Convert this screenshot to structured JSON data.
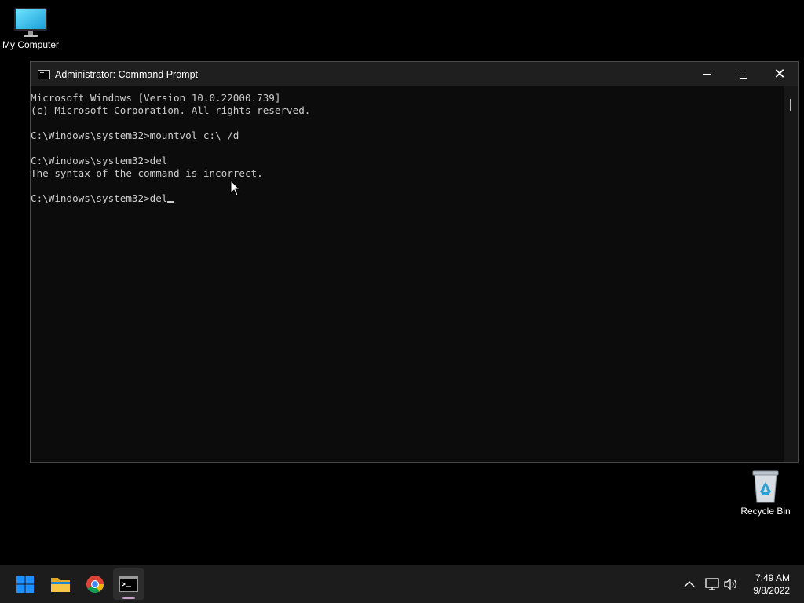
{
  "desktop": {
    "icons": [
      {
        "label": "My Computer",
        "icon": "monitor-icon"
      },
      {
        "label": "Recycle Bin",
        "icon": "recycle-bin-icon"
      }
    ]
  },
  "window": {
    "title": "Administrator: Command Prompt",
    "controls": [
      "minimize",
      "maximize",
      "close"
    ],
    "console_lines": [
      "Microsoft Windows [Version 10.0.22000.739]",
      "(c) Microsoft Corporation. All rights reserved.",
      "",
      "C:\\Windows\\system32>mountvol c:\\ /d",
      "",
      "C:\\Windows\\system32>del",
      "The syntax of the command is incorrect.",
      "",
      "C:\\Windows\\system32>del"
    ]
  },
  "taskbar": {
    "apps": [
      "start-icon",
      "file-explorer-icon",
      "chrome-icon",
      "command-prompt-icon"
    ],
    "active_app": "command-prompt-icon",
    "tray_icons": [
      "chevron-up-icon",
      "network-icon",
      "volume-icon"
    ],
    "clock": {
      "time": "7:49 AM",
      "date": "9/8/2022"
    }
  },
  "colors": {
    "console_bg": "#0c0c0c",
    "console_text": "#cccccc",
    "titlebar_bg": "#1f1f1f",
    "taskbar_bg": "#1c1c1c",
    "desktop_bg": "#000000"
  }
}
